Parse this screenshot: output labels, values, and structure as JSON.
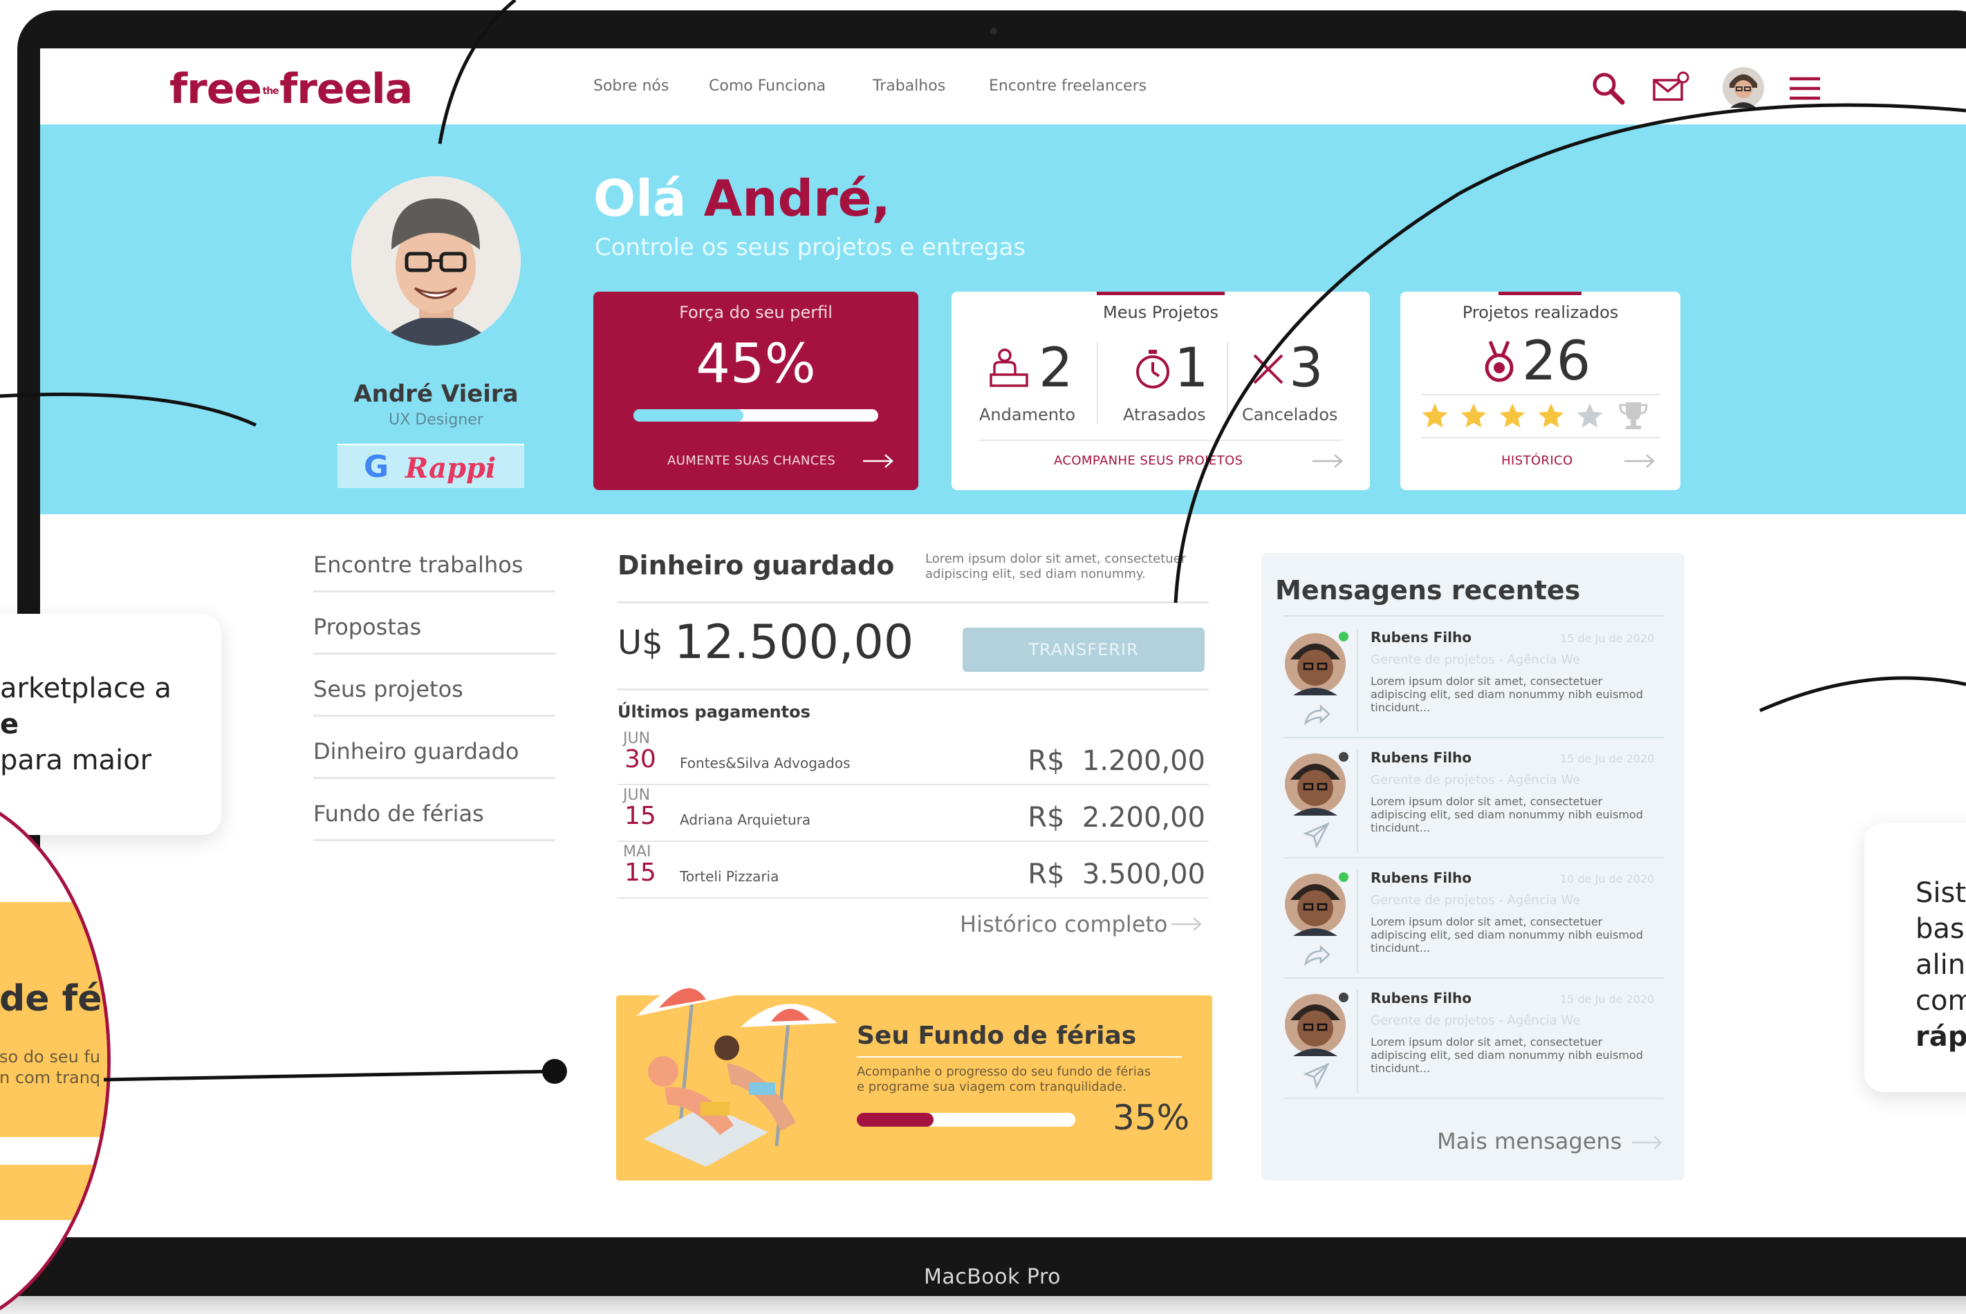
{
  "header": {
    "logo": {
      "left": "free",
      "mid": "the",
      "right": "freela"
    },
    "nav": [
      "Sobre nós",
      "Como Funciona",
      "Trabalhos",
      "Encontre freelancers"
    ],
    "icons": [
      "search-icon",
      "mail-icon",
      "avatar",
      "menu-icon"
    ]
  },
  "hero": {
    "greeting": "Olá",
    "name": "André,",
    "subtitle": "Controle os seus projetos e entregas",
    "profile": {
      "name": "André Vieira",
      "role": "UX Designer",
      "badges": [
        "G",
        "Rappi"
      ]
    }
  },
  "cards": {
    "strength": {
      "title": "Força do seu perfil",
      "value": "45%",
      "progress": 0.45,
      "link": "AUMENTE SUAS CHANCES"
    },
    "projects": {
      "title": "Meus Projetos",
      "stats": [
        {
          "icon": "person-desk-icon",
          "value": "2",
          "label": "Andamento"
        },
        {
          "icon": "stopwatch-icon",
          "value": "1",
          "label": "Atrasados"
        },
        {
          "icon": "close-icon",
          "value": "3",
          "label": "Cancelados"
        }
      ],
      "link": "ACOMPANHE SEUS PROJETOS"
    },
    "done": {
      "title": "Projetos realizados",
      "value": "26",
      "stars": 4,
      "stars_total": 5,
      "link": "HISTÓRICO"
    }
  },
  "sidebar": {
    "items": [
      "Encontre trabalhos",
      "Propostas",
      "Seus projetos",
      "Dinheiro guardado",
      "Fundo de férias"
    ]
  },
  "savings": {
    "title": "Dinheiro guardado",
    "note": "Lorem ipsum dolor sit amet, consectetuer adipiscing elit, sed diam nonummy.",
    "currency": "U$",
    "amount": "12.500,00",
    "transfer": "TRANSFERIR",
    "payments_title": "Últimos pagamentos",
    "payments": [
      {
        "month": "JUN",
        "day": "30",
        "name": "Fontes&Silva Advogados",
        "cur": "R$",
        "value": "1.200,00"
      },
      {
        "month": "JUN",
        "day": "15",
        "name": "Adriana Arquietura",
        "cur": "R$",
        "value": "2.200,00"
      },
      {
        "month": "MAI",
        "day": "15",
        "name": "Torteli Pizzaria",
        "cur": "R$",
        "value": "3.500,00"
      }
    ],
    "history_link": "Histórico completo"
  },
  "vacation": {
    "title": "Seu Fundo de férias",
    "text": "Acompanhe o progresso do seu fundo de férias e programe sua viagem com tranquilidade.",
    "value": "35%",
    "progress": 0.35
  },
  "messages": {
    "title": "Mensagens recentes",
    "items": [
      {
        "name": "Rubens Filho",
        "date": "15 de Ju de 2020",
        "role": "Gerente de projetos - Agência We",
        "text": "Lorem ipsum dolor sit amet, consectetuer adipiscing elit, sed diam nonummy nibh euismod tincidunt...",
        "online": true,
        "icon": "reply-icon"
      },
      {
        "name": "Rubens Filho",
        "date": "15 de Ju de 2020",
        "role": "Gerente de projetos - Agência We",
        "text": "Lorem ipsum dolor sit amet, consectetuer adipiscing elit, sed diam nonummy nibh euismod tincidunt...",
        "online": false,
        "icon": "send-icon"
      },
      {
        "name": "Rubens Filho",
        "date": "10 de Ju de 2020",
        "role": "Gerente de projetos - Agência We",
        "text": "Lorem ipsum dolor sit amet, consectetuer adipiscing elit, sed diam nonummy nibh euismod tincidunt...",
        "online": true,
        "icon": "reply-icon"
      },
      {
        "name": "Rubens Filho",
        "date": "15 de Ju de 2020",
        "role": "Gerente de projetos - Agência We",
        "text": "Lorem ipsum dolor sit amet, consectetuer adipiscing elit, sed diam nonummy nibh euismod tincidunt...",
        "online": false,
        "icon": "send-icon"
      }
    ],
    "more": "Mais mensagens"
  },
  "device": {
    "label": "MacBook Pro"
  },
  "callouts": {
    "left": {
      "l1": "arketplace a",
      "l2": "e",
      "l3": "para maior"
    },
    "left_zoom": {
      "title": "de fé",
      "l1": "so do seu fu",
      "l2": "n com tranq"
    },
    "right": {
      "l1": "Sist",
      "l2": "bas",
      "l3": "alin",
      "l4": "com",
      "l5": "ráp"
    }
  },
  "colors": {
    "brand": "#a5123f",
    "hero": "#86e0f4",
    "progress": "#86e0f4",
    "star": "#f6c43f",
    "vacation": "#ffc85c"
  }
}
